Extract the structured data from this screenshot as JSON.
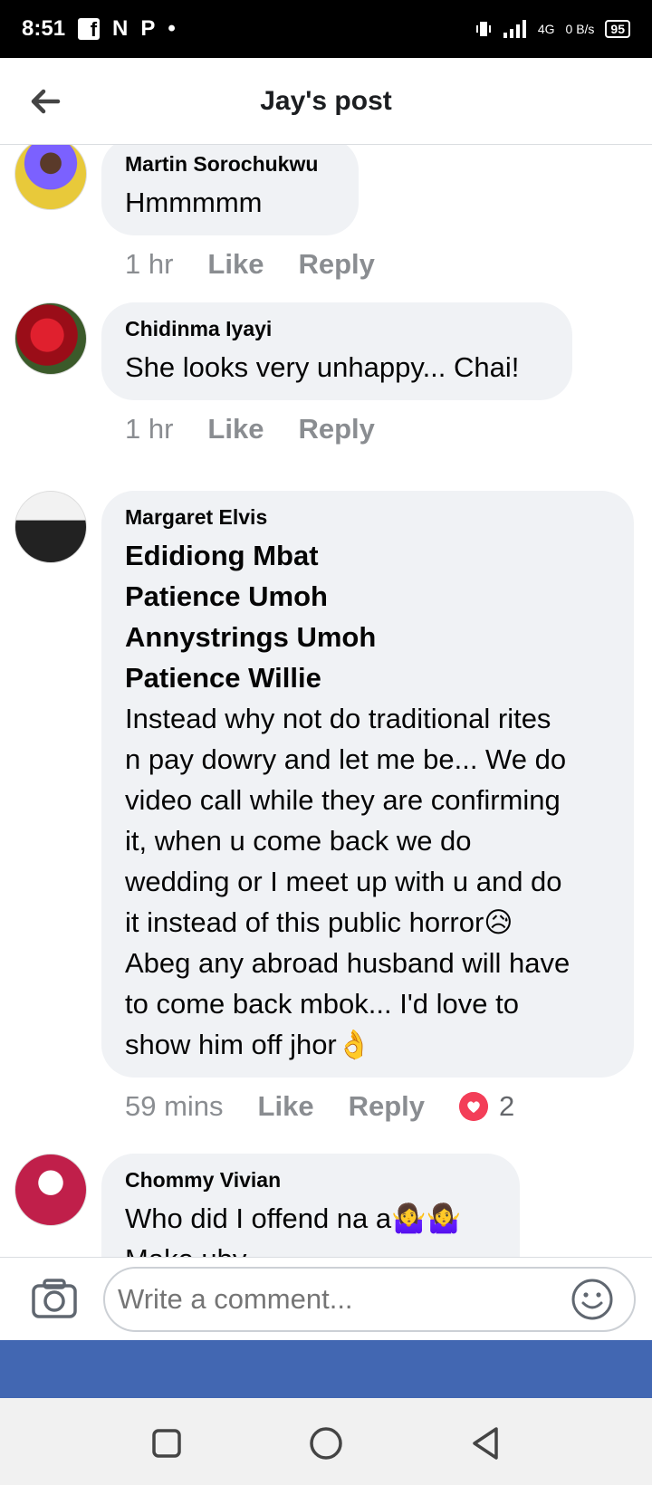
{
  "status_bar": {
    "time": "8:51",
    "indicators": [
      "facebook-icon",
      "N",
      "P",
      "•"
    ],
    "network": "4G",
    "speed": "0 B/s",
    "battery": "95"
  },
  "header": {
    "title": "Jay's post",
    "back_icon": "arrow-left-icon"
  },
  "comments": [
    {
      "author": "Martin Sorochukwu",
      "text": "Hmmmmm",
      "time": "1 hr",
      "like_label": "Like",
      "reply_label": "Reply",
      "avatar_color": "#e8c93a"
    },
    {
      "author": "Chidinma Iyayi",
      "text": "She looks very unhappy... Chai!",
      "time": "1 hr",
      "like_label": "Like",
      "reply_label": "Reply",
      "avatar_color": "#b81422"
    },
    {
      "author": "Margaret Elvis",
      "tags": [
        "Edidiong Mbat",
        "Patience Umoh",
        "Annystrings Umoh",
        "Patience Willie"
      ],
      "lines": [
        "Instead why not do traditional rites",
        "n pay dowry and let me be... We do",
        "video call while they are confirming",
        "it, when u come back we do",
        "wedding or I meet up with u and do",
        "it instead of this public horror😥",
        "Abeg any abroad husband will have",
        "to come back mbok... I'd love to",
        "show him off jhor👌"
      ],
      "time": "59 mins",
      "like_label": "Like",
      "reply_label": "Reply",
      "reaction_count": "2",
      "reaction_icon": "love-heart-icon",
      "avatar_color": "#d9d9d9"
    },
    {
      "author": "Chommy Vivian",
      "lines": [
        "Who did I offend na a🤷‍♀️🤷‍♀️",
        "Make uby"
      ],
      "avatar_color": "#a01a3a"
    }
  ],
  "composer": {
    "placeholder": "Write a comment...",
    "camera_icon": "camera-icon",
    "emoji_icon": "smiley-icon"
  },
  "colors": {
    "brand_blue": "#4267b2",
    "bubble": "#f0f2f5",
    "meta_gray": "#8a8d91",
    "love_red": "#f33e58"
  },
  "nav": {
    "icons": [
      "recent-apps-icon",
      "home-icon",
      "back-icon"
    ]
  }
}
